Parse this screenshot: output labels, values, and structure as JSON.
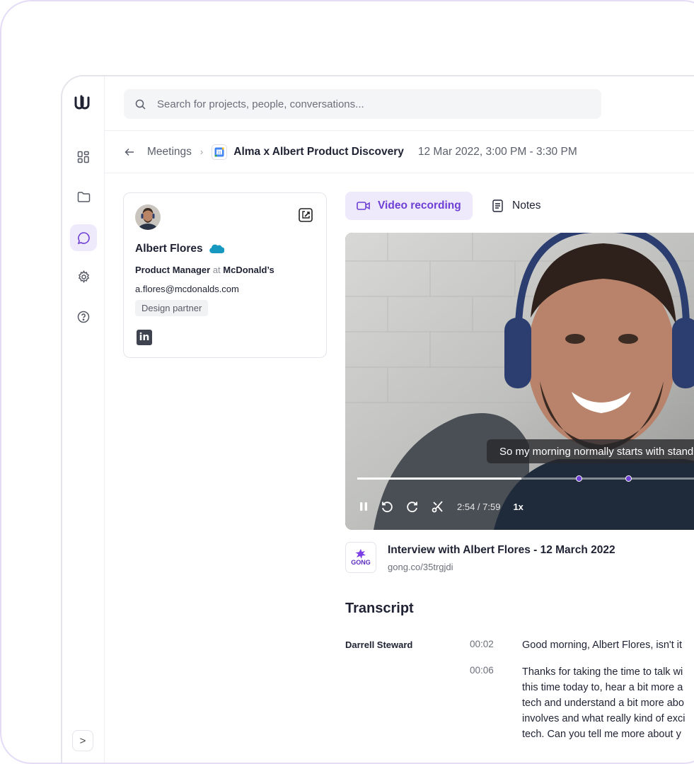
{
  "search": {
    "placeholder": "Search for projects, people, conversations..."
  },
  "breadcrumb": {
    "back_icon": "arrow-left-icon",
    "parent": "Meetings",
    "title": "Alma x Albert Product Discovery",
    "datetime": "12 Mar 2022, 3:00 PM - 3:30 PM"
  },
  "sidebar": {
    "items": [
      {
        "name": "dashboard",
        "icon": "grid-icon",
        "active": false
      },
      {
        "name": "projects",
        "icon": "folder-icon",
        "active": false
      },
      {
        "name": "conversations",
        "icon": "chat-icon",
        "active": true
      },
      {
        "name": "settings",
        "icon": "gear-icon",
        "active": false
      },
      {
        "name": "help",
        "icon": "help-icon",
        "active": false
      }
    ],
    "expand_label": ">"
  },
  "contact": {
    "name": "Albert Flores",
    "role": "Product Manager",
    "at": "at",
    "company": "McDonald’s",
    "email": "a.flores@mcdonalds.com",
    "tag": "Design partner",
    "linkedin": "in"
  },
  "tabs": {
    "video": "Video recording",
    "notes": "Notes",
    "active": "video"
  },
  "player": {
    "caption": "So my morning normally starts with stand",
    "time": "2:54 / 7:59",
    "speed": "1x",
    "progress": 0.43,
    "markers": [
      0.58,
      0.71
    ]
  },
  "recording": {
    "source_badge": "GONG",
    "title": "Interview with Albert Flores - 12 March 2022",
    "link": "gong.co/35trgjdi"
  },
  "transcript": {
    "heading": "Transcript",
    "entries": [
      {
        "speaker": "Darrell Steward",
        "time": "00:02",
        "lines": [
          "Good morning, Albert Flores, isn't it"
        ]
      },
      {
        "speaker": "",
        "time": "00:06",
        "lines": [
          "Thanks for taking the time to talk wi",
          "this time today to, hear a bit more a",
          "tech and understand a bit more abo",
          "involves and what really kind of exci",
          "tech. Can you tell me more about y"
        ]
      }
    ]
  },
  "colors": {
    "accent": "#6d3fd4",
    "accent_bg": "#efe9fc",
    "frame_border": "#e4dcf7"
  }
}
